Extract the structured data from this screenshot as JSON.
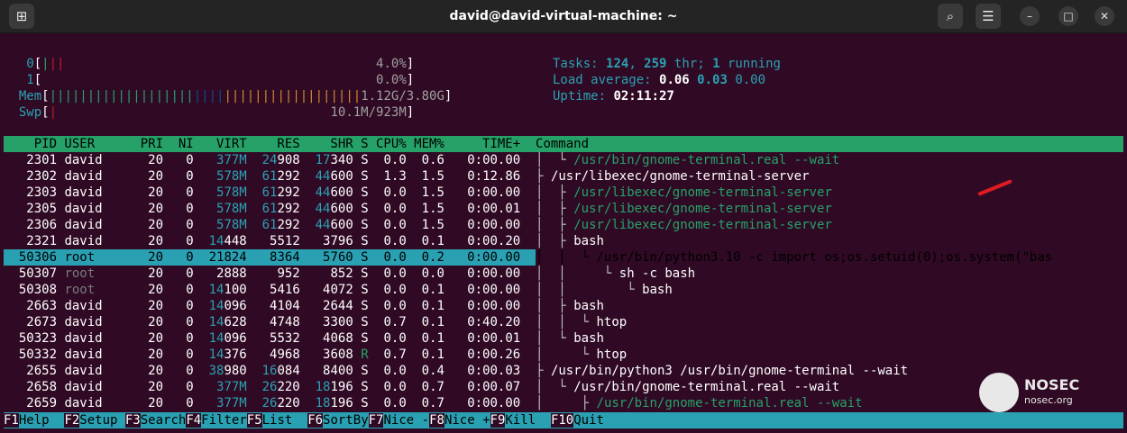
{
  "window": {
    "title": "david@david-virtual-machine: ~"
  },
  "titlebar_icons": {
    "new_tab": "new-tab-icon",
    "search": "search-icon",
    "menu": "hamburger-icon",
    "minimize": "minimize-icon",
    "maximize": "maximize-icon",
    "close": "close-icon"
  },
  "meters": {
    "cpu0_label": "0",
    "cpu0_value": "4.0%",
    "cpu1_label": "1",
    "cpu1_value": "0.0%",
    "mem_label": "Mem",
    "mem_value": "1.12G/3.80G",
    "swp_label": "Swp",
    "swp_value": "10.1M/923M"
  },
  "info": {
    "tasks_label": "Tasks:",
    "tasks": "124",
    "thr": "259",
    "thr_label": "thr;",
    "running": "1",
    "running_label": "running",
    "load_label": "Load average:",
    "load1": "0.06",
    "load5": "0.03",
    "load15": "0.00",
    "uptime_label": "Uptime:",
    "uptime": "02:11:27"
  },
  "columns": [
    "PID",
    "USER",
    "PRI",
    "NI",
    "VIRT",
    "RES",
    "SHR",
    "S",
    "CPU%",
    "MEM%",
    "TIME+",
    "Command"
  ],
  "rows": [
    {
      "pid": "2301",
      "user": "david",
      "pri": "20",
      "ni": "0",
      "virt": "377M",
      "res": "24908",
      "shr": "17340",
      "s": "S",
      "cpu": "0.0",
      "mem": "0.6",
      "time": "0:00.00",
      "tree": "│  └ ",
      "cmd": "/usr/bin/gnome-terminal.real --wait"
    },
    {
      "pid": "2302",
      "user": "david",
      "pri": "20",
      "ni": "0",
      "virt": "578M",
      "res": "61292",
      "shr": "44600",
      "s": "S",
      "cpu": "1.3",
      "mem": "1.5",
      "time": "0:12.86",
      "tree": "├ ",
      "cmd": "/usr/libexec/gnome-terminal-server"
    },
    {
      "pid": "2303",
      "user": "david",
      "pri": "20",
      "ni": "0",
      "virt": "578M",
      "res": "61292",
      "shr": "44600",
      "s": "S",
      "cpu": "0.0",
      "mem": "1.5",
      "time": "0:00.00",
      "tree": "│  ├ ",
      "cmd": "/usr/libexec/gnome-terminal-server"
    },
    {
      "pid": "2305",
      "user": "david",
      "pri": "20",
      "ni": "0",
      "virt": "578M",
      "res": "61292",
      "shr": "44600",
      "s": "S",
      "cpu": "0.0",
      "mem": "1.5",
      "time": "0:00.01",
      "tree": "│  ├ ",
      "cmd": "/usr/libexec/gnome-terminal-server"
    },
    {
      "pid": "2306",
      "user": "david",
      "pri": "20",
      "ni": "0",
      "virt": "578M",
      "res": "61292",
      "shr": "44600",
      "s": "S",
      "cpu": "0.0",
      "mem": "1.5",
      "time": "0:00.00",
      "tree": "│  ├ ",
      "cmd": "/usr/libexec/gnome-terminal-server"
    },
    {
      "pid": "2321",
      "user": "david",
      "pri": "20",
      "ni": "0",
      "virt": "14448",
      "res": "5512",
      "shr": "3796",
      "s": "S",
      "cpu": "0.0",
      "mem": "0.1",
      "time": "0:00.20",
      "tree": "│  ├ ",
      "cmd": "bash"
    },
    {
      "pid": "50306",
      "user": "root",
      "pri": "20",
      "ni": "0",
      "virt": "21824",
      "res": "8364",
      "shr": "5760",
      "s": "S",
      "cpu": "0.0",
      "mem": "0.2",
      "time": "0:00.00",
      "tree": "│  │  └ ",
      "cmd": "/usr/bin/python3.10 -c import os;os.setuid(0);os.system(\"bas"
    },
    {
      "pid": "50307",
      "user": "root",
      "pri": "20",
      "ni": "0",
      "virt": "2888",
      "res": "952",
      "shr": "852",
      "s": "S",
      "cpu": "0.0",
      "mem": "0.0",
      "time": "0:00.00",
      "tree": "│  │     └ ",
      "cmd": "sh -c bash"
    },
    {
      "pid": "50308",
      "user": "root",
      "pri": "20",
      "ni": "0",
      "virt": "14100",
      "res": "5416",
      "shr": "4072",
      "s": "S",
      "cpu": "0.0",
      "mem": "0.1",
      "time": "0:00.00",
      "tree": "│  │        └ ",
      "cmd": "bash"
    },
    {
      "pid": "2663",
      "user": "david",
      "pri": "20",
      "ni": "0",
      "virt": "14096",
      "res": "4104",
      "shr": "2644",
      "s": "S",
      "cpu": "0.0",
      "mem": "0.1",
      "time": "0:00.00",
      "tree": "│  ├ ",
      "cmd": "bash"
    },
    {
      "pid": "2673",
      "user": "david",
      "pri": "20",
      "ni": "0",
      "virt": "14628",
      "res": "4748",
      "shr": "3300",
      "s": "S",
      "cpu": "0.7",
      "mem": "0.1",
      "time": "0:40.20",
      "tree": "│  │  └ ",
      "cmd": "htop"
    },
    {
      "pid": "50323",
      "user": "david",
      "pri": "20",
      "ni": "0",
      "virt": "14096",
      "res": "5532",
      "shr": "4068",
      "s": "S",
      "cpu": "0.0",
      "mem": "0.1",
      "time": "0:00.01",
      "tree": "│  └ ",
      "cmd": "bash"
    },
    {
      "pid": "50332",
      "user": "david",
      "pri": "20",
      "ni": "0",
      "virt": "14376",
      "res": "4968",
      "shr": "3608",
      "s": "R",
      "cpu": "0.7",
      "mem": "0.1",
      "time": "0:00.26",
      "tree": "│     └ ",
      "cmd": "htop"
    },
    {
      "pid": "2655",
      "user": "david",
      "pri": "20",
      "ni": "0",
      "virt": "38980",
      "res": "16084",
      "shr": "8400",
      "s": "S",
      "cpu": "0.0",
      "mem": "0.4",
      "time": "0:00.03",
      "tree": "├ ",
      "cmd": "/usr/bin/python3 /usr/bin/gnome-terminal --wait"
    },
    {
      "pid": "2658",
      "user": "david",
      "pri": "20",
      "ni": "0",
      "virt": "377M",
      "res": "26220",
      "shr": "18196",
      "s": "S",
      "cpu": "0.0",
      "mem": "0.7",
      "time": "0:00.07",
      "tree": "│  └ ",
      "cmd": "/usr/bin/gnome-terminal.real --wait"
    },
    {
      "pid": "2659",
      "user": "david",
      "pri": "20",
      "ni": "0",
      "virt": "377M",
      "res": "26220",
      "shr": "18196",
      "s": "S",
      "cpu": "0.0",
      "mem": "0.7",
      "time": "0:00.00",
      "tree": "│     ├ ",
      "cmd": "/usr/bin/gnome-terminal.real --wait"
    }
  ],
  "fkeys": [
    {
      "key": "F1",
      "label": "Help  "
    },
    {
      "key": "F2",
      "label": "Setup "
    },
    {
      "key": "F3",
      "label": "Search"
    },
    {
      "key": "F4",
      "label": "Filter"
    },
    {
      "key": "F5",
      "label": "List  "
    },
    {
      "key": "F6",
      "label": "SortBy"
    },
    {
      "key": "F7",
      "label": "Nice -"
    },
    {
      "key": "F8",
      "label": "Nice +"
    },
    {
      "key": "F9",
      "label": "Kill  "
    },
    {
      "key": "F10",
      "label": "Quit"
    }
  ],
  "logo": {
    "name": "NOSEC",
    "url": "nosec.org"
  },
  "colors": {
    "bg": "#300a24",
    "green": "#26a269",
    "cyan": "#2aa1b3",
    "red": "#c01c28"
  }
}
